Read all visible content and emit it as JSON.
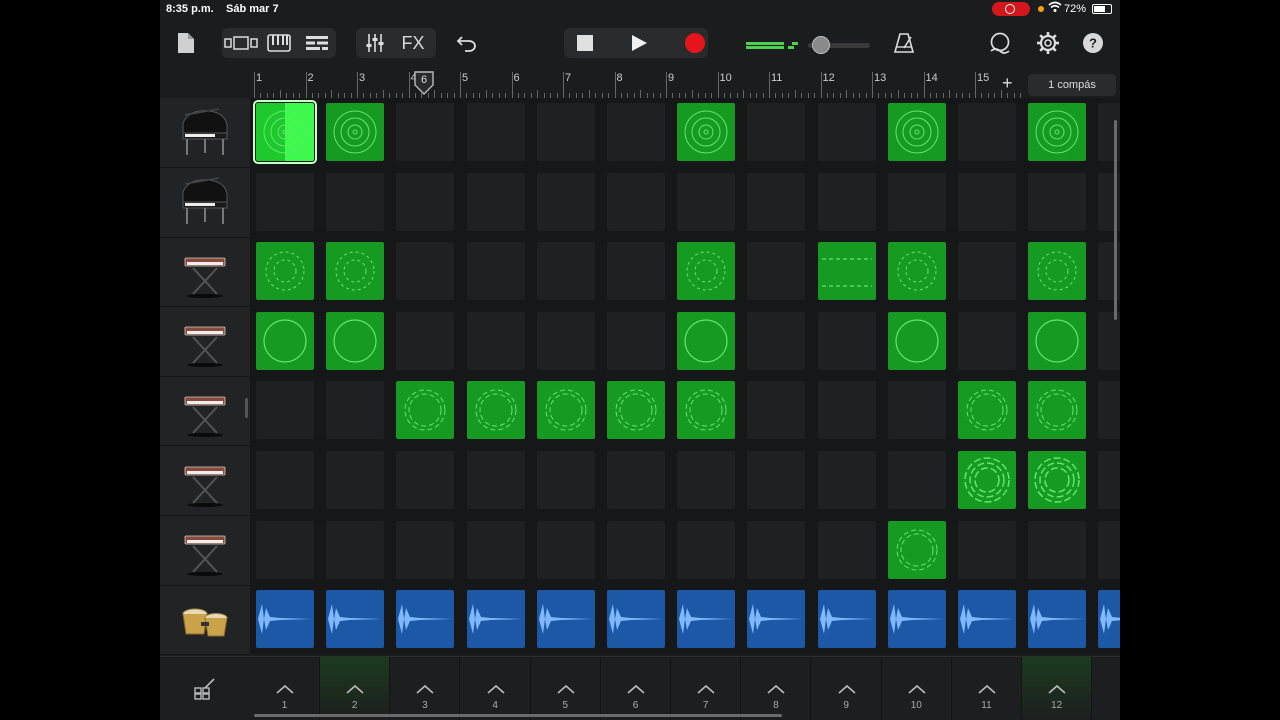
{
  "status_bar": {
    "time": "8:35 p.m.",
    "date": "Sáb mar 7",
    "battery": "72%"
  },
  "toolbar": {
    "fx_label": "FX"
  },
  "ruler": {
    "bars": [
      "1",
      "2",
      "3",
      "4",
      "5",
      "6",
      "7",
      "8",
      "9",
      "10",
      "11",
      "12",
      "13",
      "14",
      "15"
    ],
    "playhead_bar": "6",
    "add_label": "+",
    "length_label": "1 compás"
  },
  "tracks": [
    {
      "instrument": "grand-piano"
    },
    {
      "instrument": "grand-piano"
    },
    {
      "instrument": "synth-keyboard"
    },
    {
      "instrument": "synth-keyboard"
    },
    {
      "instrument": "synth-keyboard"
    },
    {
      "instrument": "synth-keyboard"
    },
    {
      "instrument": "synth-keyboard"
    },
    {
      "instrument": "bongos"
    }
  ],
  "grid": {
    "columns": 12,
    "rows": [
      {
        "cells": [
          "g",
          "g",
          ".",
          ".",
          ".",
          ".",
          "g",
          ".",
          ".",
          "g",
          ".",
          "g"
        ],
        "selected": 0,
        "style": "rings"
      },
      {
        "cells": [
          ".",
          ".",
          ".",
          ".",
          ".",
          ".",
          ".",
          ".",
          ".",
          ".",
          ".",
          "."
        ],
        "style": "none"
      },
      {
        "cells": [
          "g",
          "g",
          ".",
          ".",
          ".",
          ".",
          "g",
          ".",
          "g",
          "g",
          ".",
          "g"
        ],
        "style": "dashed"
      },
      {
        "cells": [
          "g",
          "g",
          ".",
          ".",
          ".",
          ".",
          "g",
          ".",
          ".",
          "g",
          ".",
          "g"
        ],
        "style": "circle"
      },
      {
        "cells": [
          ".",
          ".",
          "g",
          "g",
          "g",
          "g",
          "g",
          ".",
          ".",
          ".",
          "g",
          "g"
        ],
        "style": "wave"
      },
      {
        "cells": [
          ".",
          ".",
          ".",
          ".",
          ".",
          ".",
          ".",
          ".",
          ".",
          ".",
          "g",
          "g"
        ],
        "style": "arp"
      },
      {
        "cells": [
          ".",
          ".",
          ".",
          ".",
          ".",
          ".",
          ".",
          ".",
          ".",
          "g",
          ".",
          "."
        ],
        "style": "wave"
      },
      {
        "cells": [
          "b",
          "b",
          "b",
          "b",
          "b",
          "b",
          "b",
          "b",
          "b",
          "b",
          "b",
          "b",
          "b"
        ],
        "style": "audio"
      }
    ]
  },
  "column_triggers": [
    "1",
    "2",
    "3",
    "4",
    "5",
    "6",
    "7",
    "8",
    "9",
    "10",
    "11",
    "12"
  ],
  "active_triggers": [
    "2",
    "12"
  ],
  "colors": {
    "green": "#169a22",
    "selected_green": "#3dfa4c",
    "blue": "#1d58a6",
    "record": "#e8141c"
  }
}
